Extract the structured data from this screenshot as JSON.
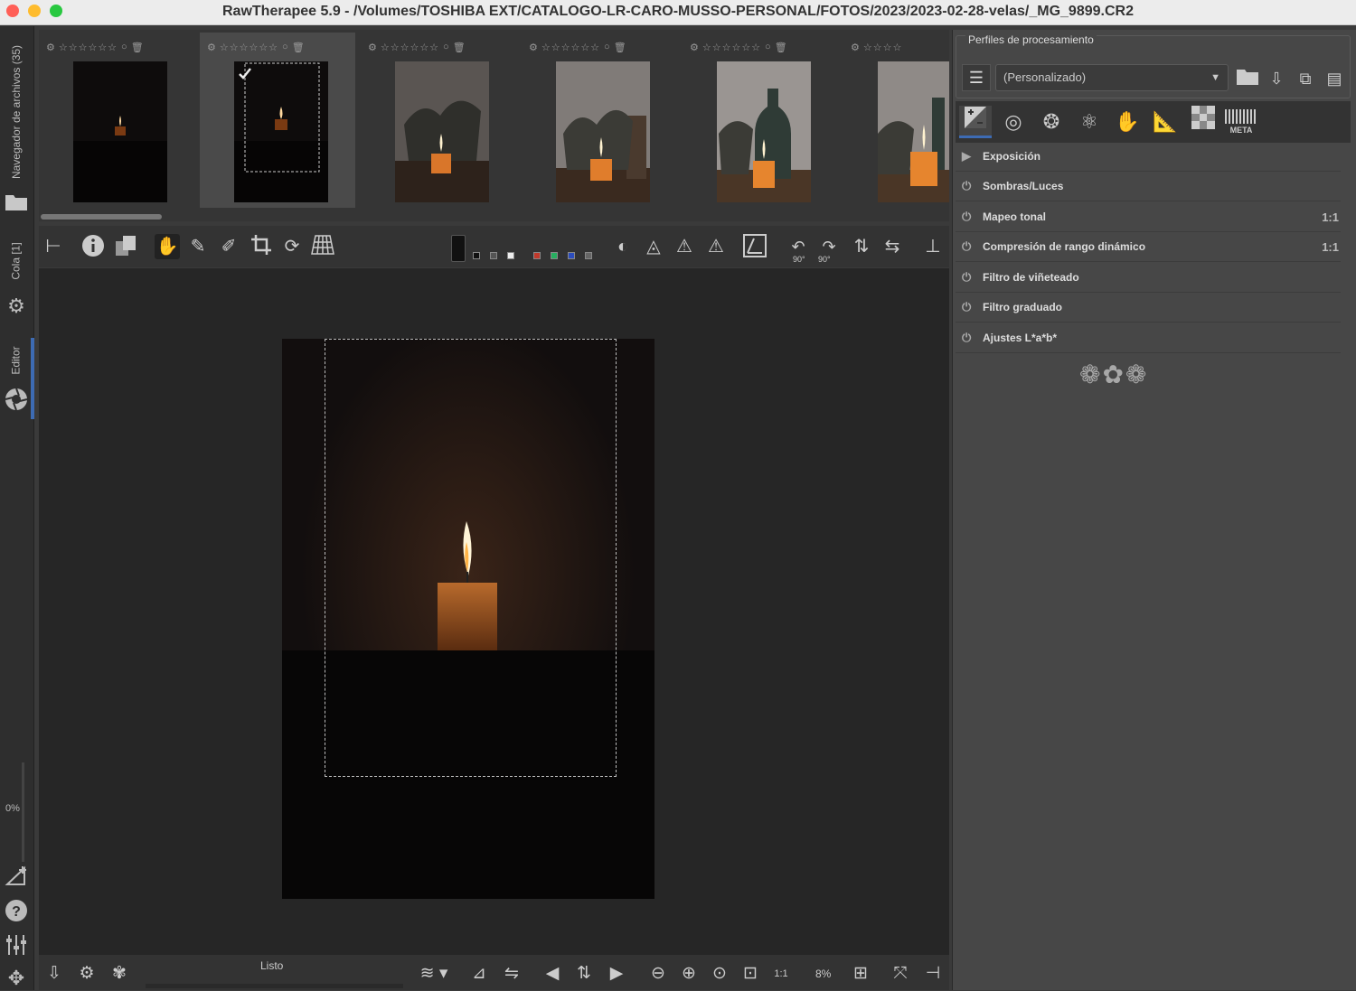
{
  "window": {
    "title": "RawTherapee 5.9 - /Volumes/TOSHIBA EXT/CATALOGO-LR-CARO-MUSSO-PERSONAL/FOTOS/2023/2023-02-28-velas/_MG_9899.CR2"
  },
  "leftbar": {
    "tabs": [
      {
        "label": "Navegador de archivos (35)"
      },
      {
        "label": "Cola [1]"
      },
      {
        "label": "Editor"
      }
    ],
    "progress_label": "0%"
  },
  "filmstrip": {
    "thumbnails": [
      {
        "stars": "☆☆☆☆☆☆",
        "selected": false,
        "checked": false
      },
      {
        "stars": "☆☆☆☆☆☆",
        "selected": true,
        "checked": true
      },
      {
        "stars": "☆☆☆☆☆☆",
        "selected": false,
        "checked": false
      },
      {
        "stars": "☆☆☆☆☆☆",
        "selected": false,
        "checked": false
      },
      {
        "stars": "☆☆☆☆☆☆",
        "selected": false,
        "checked": false
      },
      {
        "stars": "☆☆☆☆",
        "selected": false,
        "checked": false
      }
    ]
  },
  "toolbar": {
    "rotate_left_label": "90°",
    "rotate_right_label": "90°"
  },
  "bottombar": {
    "status": "Listo",
    "zoom": "8%",
    "zoom_fit_label": "1:1"
  },
  "rightpanel": {
    "profiles_title": "Perfiles de procesamiento",
    "profile_selected": "(Personalizado)",
    "meta_tab_label": "META",
    "tools": [
      {
        "label": "Exposición",
        "expander": "▶",
        "badge": ""
      },
      {
        "label": "Sombras/Luces",
        "expander": "⏻",
        "badge": ""
      },
      {
        "label": "Mapeo tonal",
        "expander": "⏻",
        "badge": "1:1"
      },
      {
        "label": "Compresión de rango dinámico",
        "expander": "⏻",
        "badge": "1:1"
      },
      {
        "label": "Filtro de viñeteado",
        "expander": "⏻",
        "badge": ""
      },
      {
        "label": "Filtro graduado",
        "expander": "⏻",
        "badge": ""
      },
      {
        "label": "Ajustes L*a*b*",
        "expander": "⏻",
        "badge": ""
      }
    ],
    "ornament": "❁✿❁"
  },
  "colors": {
    "accent": "#3d6bb3",
    "panel_bg": "#474747",
    "canvas_bg": "#262626"
  }
}
